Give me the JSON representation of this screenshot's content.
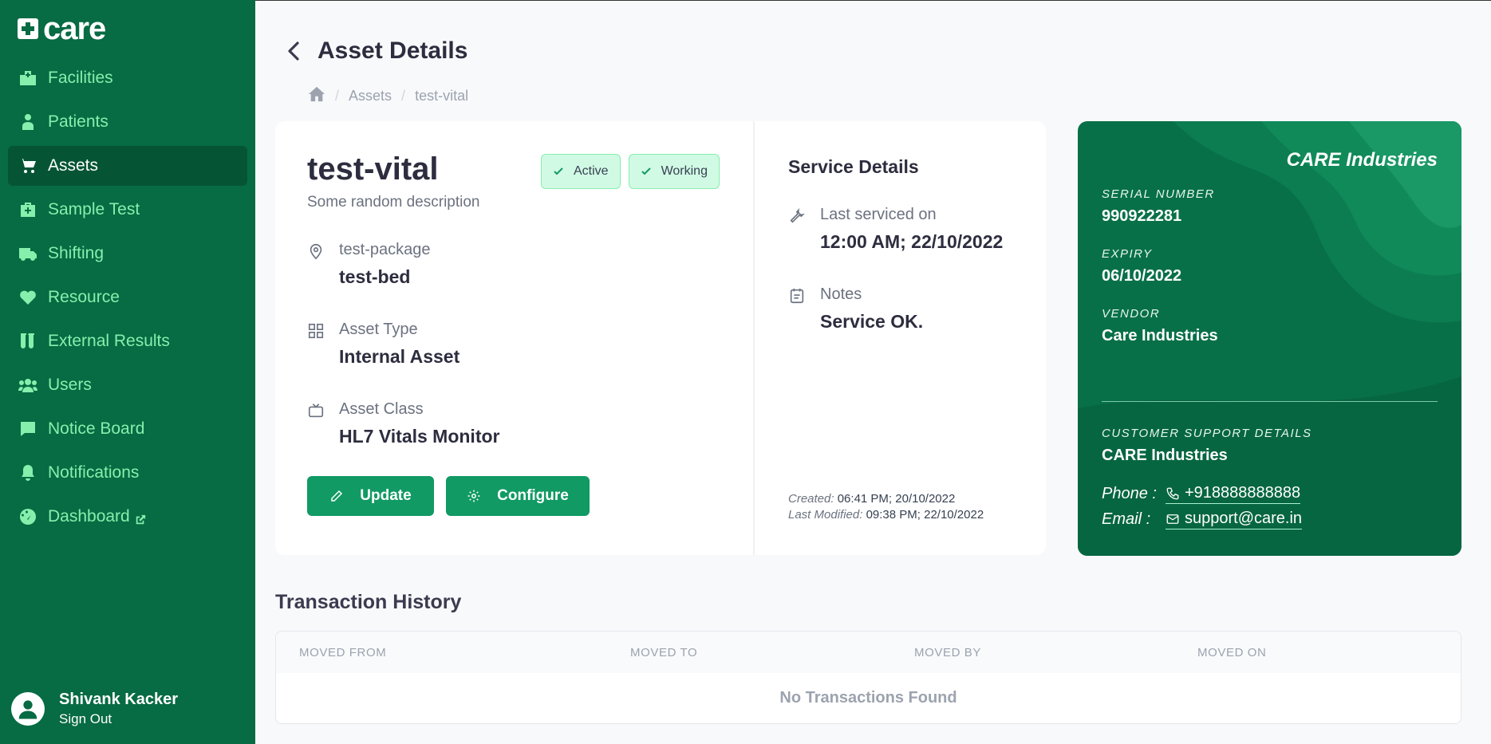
{
  "app": {
    "name": "care"
  },
  "sidebar": {
    "items": [
      {
        "label": "Facilities",
        "icon": "hospital-icon"
      },
      {
        "label": "Patients",
        "icon": "user-injured-icon"
      },
      {
        "label": "Assets",
        "icon": "shopping-cart-icon",
        "active": true
      },
      {
        "label": "Sample Test",
        "icon": "medkit-icon"
      },
      {
        "label": "Shifting",
        "icon": "ambulance-icon"
      },
      {
        "label": "Resource",
        "icon": "heartbeat-icon"
      },
      {
        "label": "External Results",
        "icon": "vials-icon"
      },
      {
        "label": "Users",
        "icon": "users-icon"
      },
      {
        "label": "Notice Board",
        "icon": "comment-icon"
      },
      {
        "label": "Notifications",
        "icon": "bell-icon"
      },
      {
        "label": "Dashboard",
        "icon": "dashboard-icon",
        "external": true
      }
    ]
  },
  "user": {
    "name": "Shivank Kacker",
    "sign_out": "Sign Out"
  },
  "header": {
    "title": "Asset Details"
  },
  "breadcrumb": {
    "items": [
      "Assets",
      "test-vital"
    ]
  },
  "asset": {
    "name": "test-vital",
    "description": "Some random description",
    "badges": [
      "Active",
      "Working"
    ],
    "location_label": "test-package",
    "location_value": "test-bed",
    "type_label": "Asset Type",
    "type_value": "Internal Asset",
    "class_label": "Asset Class",
    "class_value": "HL7 Vitals Monitor",
    "update_label": "Update",
    "configure_label": "Configure"
  },
  "service": {
    "title": "Service Details",
    "last_serviced_label": "Last serviced on",
    "last_serviced_value": "12:00 AM; 22/10/2022",
    "notes_label": "Notes",
    "notes_value": "Service OK.",
    "created_label": "Created:",
    "created_value": "06:41 PM; 20/10/2022",
    "modified_label": "Last Modified:",
    "modified_value": "09:38 PM; 22/10/2022"
  },
  "warranty": {
    "brand": "CARE Industries",
    "serial_label": "SERIAL NUMBER",
    "serial_value": "990922281",
    "expiry_label": "EXPIRY",
    "expiry_value": "06/10/2022",
    "vendor_label": "VENDOR",
    "vendor_value": "Care Industries",
    "support_label": "CUSTOMER SUPPORT DETAILS",
    "support_name": "CARE Industries",
    "phone_label": "Phone :",
    "phone_value": "+918888888888",
    "email_label": "Email :",
    "email_value": "support@care.in"
  },
  "transactions": {
    "title": "Transaction History",
    "columns": [
      "MOVED FROM",
      "MOVED TO",
      "MOVED BY",
      "MOVED ON"
    ],
    "empty": "No Transactions Found"
  },
  "colors": {
    "sidebar": "#076b43",
    "accent": "#119a63",
    "nav_text": "#86efac"
  }
}
